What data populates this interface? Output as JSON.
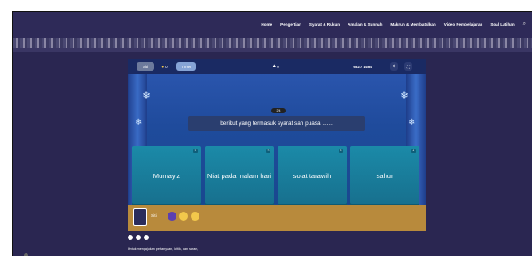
{
  "nav": {
    "items": [
      "Home",
      "Pengertian",
      "Syarat & Rukun",
      "Amalan & Sunnah",
      "Makruh & Membatalkan",
      "Video Pembelajaran",
      "Soal Latihan"
    ],
    "search_icon": "search-icon"
  },
  "game": {
    "player_name": "Siti",
    "coins": "0",
    "timer_label": "Timer",
    "player_count": "0",
    "code": "6527 4464",
    "question_counter": "2/4",
    "question": "berikut yang termasuk syarat sah puasa .......",
    "answers": [
      {
        "num": "1",
        "label": "Mumayiz"
      },
      {
        "num": "2",
        "label": "Niat pada malam hari"
      },
      {
        "num": "3",
        "label": "solat tarawih"
      },
      {
        "num": "4",
        "label": "sahur"
      }
    ],
    "footer_label": "Siti"
  },
  "footer": {
    "caption": "Untuk mengajukan pertanyaan, kritik, dan saran,"
  },
  "colors": {
    "page_bg": "#2a2651",
    "answer_card": "#1b8aa8",
    "question_box": "#2a3e6f",
    "stage_blue": "#1f4b9c"
  }
}
